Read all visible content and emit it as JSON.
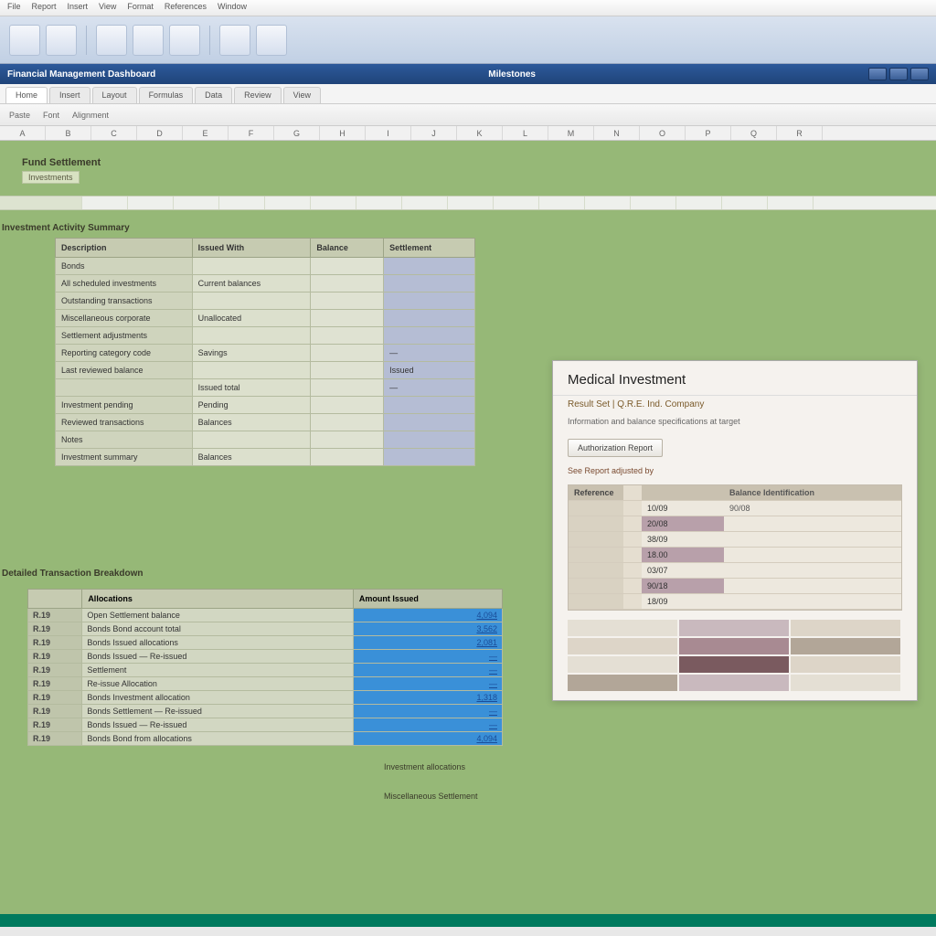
{
  "os_menu": [
    "File",
    "Report",
    "Insert",
    "View",
    "Format",
    "References",
    "Window"
  ],
  "titlebar": {
    "left": "Financial Management Dashboard",
    "center": "Milestones"
  },
  "ribbon_tabs": [
    "Home",
    "Insert",
    "Layout",
    "Formulas",
    "Data",
    "Review",
    "View"
  ],
  "columns": [
    "A",
    "B",
    "C",
    "D",
    "E",
    "F",
    "G",
    "H",
    "I",
    "J",
    "K",
    "L",
    "M",
    "N",
    "O",
    "P",
    "Q",
    "R"
  ],
  "panel": {
    "title": "Fund Settlement",
    "subtitle": "Investments"
  },
  "section1_label": "Investment Activity Summary",
  "main_grid": {
    "headers": [
      "Description",
      "Issued With",
      "Balance",
      "Settlement"
    ],
    "rows": [
      [
        "Bonds",
        "",
        "",
        ""
      ],
      [
        "All scheduled investments",
        "Current balances",
        "",
        ""
      ],
      [
        "Outstanding transactions",
        "",
        "",
        ""
      ],
      [
        "Miscellaneous corporate",
        "Unallocated",
        "",
        ""
      ],
      [
        "Settlement adjustments",
        "",
        "",
        ""
      ],
      [
        "Reporting category code",
        "Savings",
        "",
        "—"
      ],
      [
        "Last reviewed balance",
        "",
        "",
        "Issued"
      ],
      [
        "",
        "Issued total",
        "",
        "—"
      ],
      [
        "Investment pending",
        "Pending",
        "",
        ""
      ],
      [
        "Reviewed transactions",
        "Balances",
        "",
        ""
      ],
      [
        "Notes",
        "",
        "",
        ""
      ],
      [
        "Investment summary",
        "Balances",
        "",
        ""
      ]
    ]
  },
  "section2_label": "Detailed Transaction Breakdown",
  "lower_grid": {
    "headers": [
      "",
      "Allocations",
      "Amount Issued"
    ],
    "rows": [
      [
        "R.19",
        "Open",
        "Settlement balance",
        "4,094"
      ],
      [
        "R.19",
        "Bonds",
        "Bond account total",
        "3,562"
      ],
      [
        "R.19",
        "Bonds",
        "Issued allocations",
        "2,081"
      ],
      [
        "R.19",
        "Bonds",
        "Issued — Re-issued",
        "—"
      ],
      [
        "R.19",
        "",
        "Settlement",
        "—"
      ],
      [
        "R.19",
        "",
        "Re-issue Allocation",
        "—"
      ],
      [
        "R.19",
        "Bonds",
        "Investment allocation",
        "1,318"
      ],
      [
        "R.19",
        "Bonds",
        "Settlement — Re-issued",
        "—"
      ],
      [
        "R.19",
        "Bonds",
        "Issued — Re-issued",
        "—"
      ],
      [
        "R.19",
        "Bonds",
        "Bond from allocations",
        "4,094"
      ]
    ]
  },
  "foot_labels": [
    "Investment allocations",
    "Miscellaneous Settlement"
  ],
  "side_card": {
    "title": "Medical Investment",
    "meta": "Result Set | Q.R.E. Ind. Company",
    "sub": "Information and balance specifications at target",
    "button": "Authorization Report",
    "subhead": "See Report adjusted by",
    "table": {
      "left_header": "Reference",
      "right_header": "Balance Identification",
      "rows": [
        [
          "",
          "10/09",
          "90/08"
        ],
        [
          "",
          "20/08",
          ""
        ],
        [
          "",
          "38/09",
          ""
        ],
        [
          "",
          "18.00",
          ""
        ],
        [
          "",
          "03/07",
          ""
        ],
        [
          "",
          "90/18",
          ""
        ],
        [
          "",
          "18/09",
          ""
        ]
      ]
    }
  }
}
